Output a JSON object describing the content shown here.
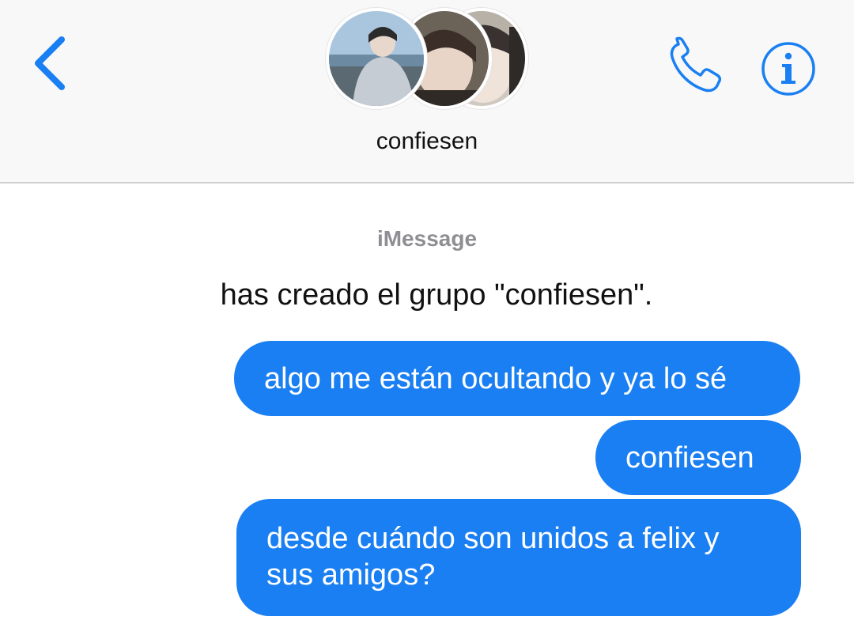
{
  "header": {
    "group_name": "confiesen",
    "back_icon": "chevron-left-icon",
    "call_icon": "phone-icon",
    "info_icon": "info-icon",
    "accent_color": "#1a7ff2"
  },
  "conversation": {
    "service_label": "iMessage",
    "system_message": "has creado el grupo \"confiesen\".",
    "messages": [
      {
        "text": "algo me están ocultando y ya lo sé",
        "sender": "me"
      },
      {
        "text": "confiesen",
        "sender": "me"
      },
      {
        "text": "desde cuándo son unidos a felix y sus amigos?",
        "sender": "me"
      }
    ],
    "bubble_color": "#1a7ff2"
  }
}
